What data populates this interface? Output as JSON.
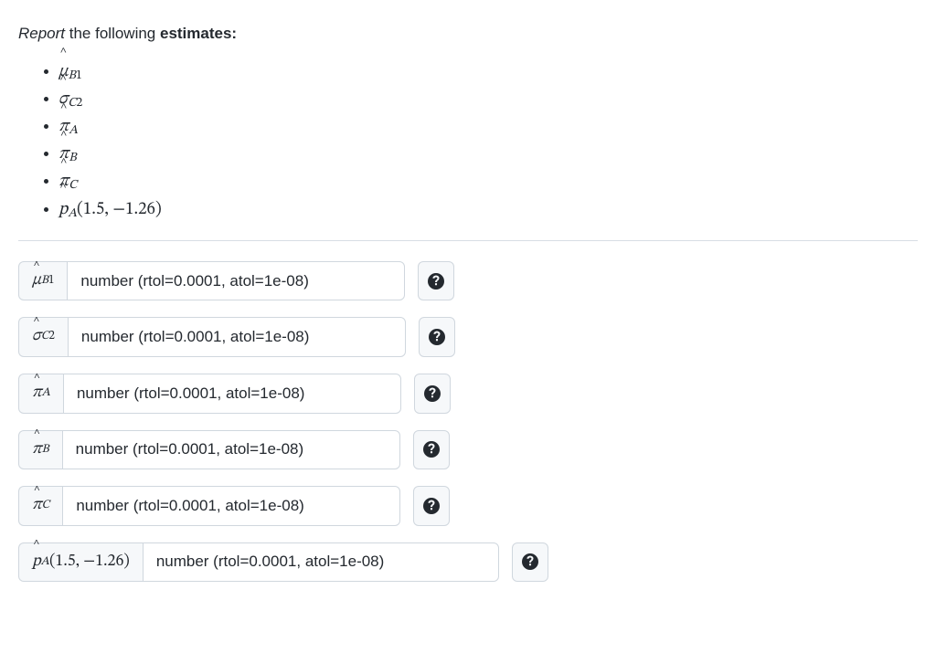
{
  "prompt": {
    "word_report": "Report",
    "middle": " the following ",
    "word_estimates": "estimates:"
  },
  "list_items": {
    "mu_b1": {
      "sym": "μ",
      "sub_letter": "B",
      "sub_num": "1"
    },
    "sigma_c2": {
      "sym": "σ",
      "sub_letter": "C",
      "sub_num": "2"
    },
    "pi_a": {
      "sym": "π",
      "sub_letter": "A"
    },
    "pi_b": {
      "sym": "π",
      "sub_letter": "B"
    },
    "pi_c": {
      "sym": "π",
      "sub_letter": "C"
    },
    "p_a_args": {
      "sym": "p",
      "sub_letter": "A",
      "args": "(1.5, −1.26)"
    }
  },
  "placeholder": "number (rtol=0.0001, atol=1e-08)",
  "input_width_std": "370px",
  "input_width_wide": "390px",
  "hat_top_greek": "-0.30em",
  "hat_top_p": "-0.50em"
}
